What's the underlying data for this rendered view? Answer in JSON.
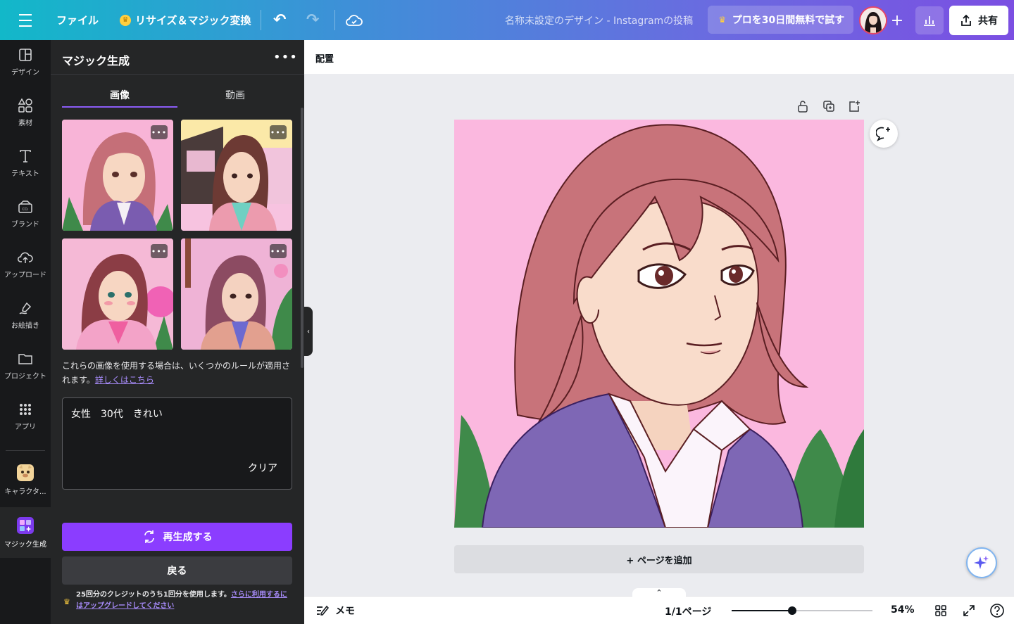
{
  "topbar": {
    "file_label": "ファイル",
    "resize_label": "リサイズ＆マジック変換",
    "design_title": "名称未設定のデザイン - Instagramの投稿",
    "pro_label": "プロを30日間無料で試す",
    "share_label": "共有"
  },
  "rail": {
    "items": [
      {
        "label": "デザイン",
        "icon": "layout-icon"
      },
      {
        "label": "素材",
        "icon": "elements-icon"
      },
      {
        "label": "テキスト",
        "icon": "text-icon"
      },
      {
        "label": "ブランド",
        "icon": "brand-icon"
      },
      {
        "label": "アップロード",
        "icon": "upload-icon"
      },
      {
        "label": "お絵描き",
        "icon": "draw-icon"
      },
      {
        "label": "プロジェクト",
        "icon": "folder-icon"
      },
      {
        "label": "アプリ",
        "icon": "apps-icon"
      },
      {
        "label": "キャラクタ...",
        "icon": "character-icon"
      },
      {
        "label": "マジック生成",
        "icon": "magic-media-icon"
      }
    ]
  },
  "panel": {
    "title": "マジック生成",
    "tabs": [
      "画像",
      "動画"
    ],
    "active_tab": "画像",
    "note_text": "これらの画像を使用する場合は、いくつかのルールが適用されます。",
    "note_link": "詳しくはこちら",
    "prompt_text": "女性　30代　きれい",
    "clear_label": "クリア",
    "regenerate_label": "再生成する",
    "back_label": "戻る",
    "credit_text": "25回分のクレジットのうち1回分を使用します。",
    "credit_link": "さらに利用するにはアップグレードしてください"
  },
  "canvas": {
    "header_label": "配置",
    "add_page_label": "+ ページを追加"
  },
  "bottombar": {
    "notes_label": "メモ",
    "page_indicator": "1/1ページ",
    "zoom_label": "54%",
    "zoom_value": 54
  },
  "colors": {
    "accent": "#8b3dff",
    "canvas_bg": "#fbb8df"
  }
}
